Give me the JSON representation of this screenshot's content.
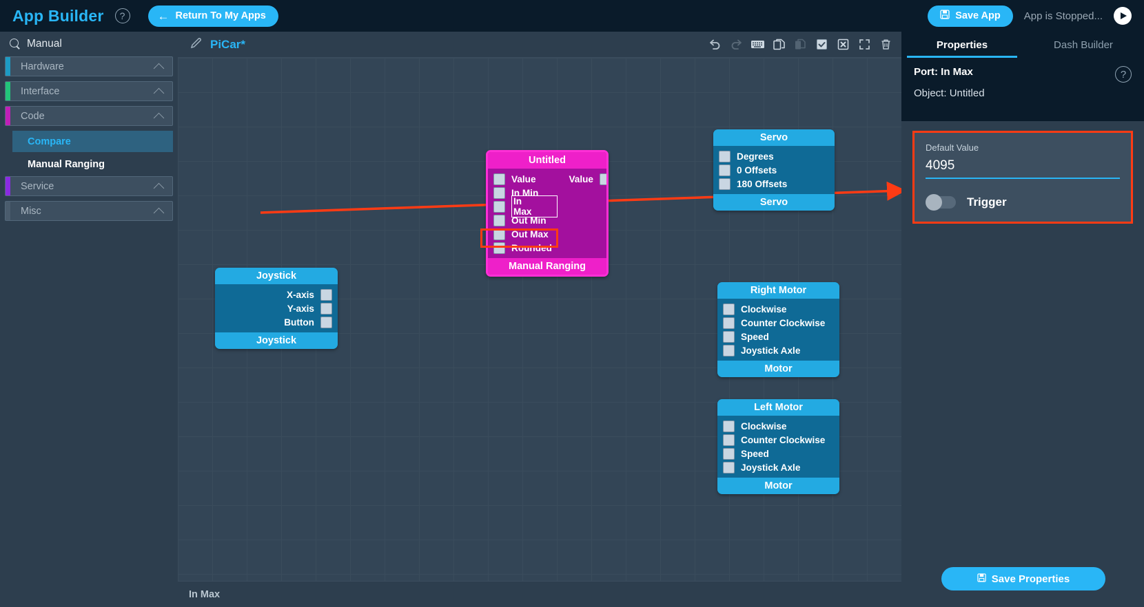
{
  "topbar": {
    "brand": "App Builder",
    "help_icon": "question-circle-icon",
    "return_label": "Return To My Apps",
    "back_arrow": "←",
    "save_app_label": "Save App",
    "save_icon": "floppy-disk-icon",
    "app_status": "App is Stopped...",
    "play_icon": "play-circle-icon"
  },
  "sidebar": {
    "search_icon": "search-icon",
    "search_value": "Manual",
    "categories": [
      {
        "label": "Hardware",
        "color": "#1d9bc4",
        "expanded": true
      },
      {
        "label": "Interface",
        "color": "#22c47a",
        "expanded": true
      },
      {
        "label": "Code",
        "color": "#c020b8",
        "expanded": true
      },
      {
        "label": "Service",
        "color": "#8a2be2",
        "expanded": true
      },
      {
        "label": "Misc",
        "color": "#4a5c6d",
        "expanded": true
      }
    ],
    "code_children": [
      {
        "label": "Compare",
        "active": true
      },
      {
        "label": "Manual Ranging",
        "active": false
      }
    ]
  },
  "canvas": {
    "pencil_icon": "pencil-icon",
    "project_title": "PiCar*",
    "status_text": "In Max",
    "toolbar": [
      {
        "name": "undo-icon",
        "label": "Undo",
        "enabled": true
      },
      {
        "name": "redo-icon",
        "label": "Redo",
        "enabled": false
      },
      {
        "name": "keyboard-icon",
        "label": "Keyboard",
        "enabled": true
      },
      {
        "name": "copy-icon",
        "label": "Copy",
        "enabled": true
      },
      {
        "name": "paste-icon",
        "label": "Paste",
        "enabled": false
      },
      {
        "name": "select-all-icon",
        "label": "Select All",
        "enabled": true
      },
      {
        "name": "deselect-icon",
        "label": "Deselect",
        "enabled": true
      },
      {
        "name": "fullscreen-icon",
        "label": "Fullscreen",
        "enabled": true
      },
      {
        "name": "trash-icon",
        "label": "Delete",
        "enabled": true
      }
    ]
  },
  "nodes": {
    "manual_ranging": {
      "header": "Untitled",
      "footer": "Manual Ranging",
      "inputs": [
        "Value",
        "In Min",
        "In Max",
        "Out Min",
        "Out Max",
        "Rounded"
      ],
      "outputs": [
        "Value"
      ],
      "selected_port": "In Max"
    },
    "servo": {
      "header": "Servo",
      "footer": "Servo",
      "inputs": [
        "Degrees",
        "0 Offsets",
        "180 Offsets"
      ]
    },
    "joystick": {
      "header": "Joystick",
      "footer": "Joystick",
      "outputs": [
        "X-axis",
        "Y-axis",
        "Button"
      ]
    },
    "right_motor": {
      "header": "Right Motor",
      "footer": "Motor",
      "inputs": [
        "Clockwise",
        "Counter Clockwise",
        "Speed",
        "Joystick Axle"
      ]
    },
    "left_motor": {
      "header": "Left Motor",
      "footer": "Motor",
      "inputs": [
        "Clockwise",
        "Counter Clockwise",
        "Speed",
        "Joystick Axle"
      ]
    }
  },
  "properties": {
    "tabs": [
      {
        "label": "Properties",
        "active": true
      },
      {
        "label": "Dash Builder",
        "active": false
      }
    ],
    "port_line_label": "Port:",
    "port_line_value": "In Max",
    "object_line_label": "Object:",
    "object_line_value": "Untitled",
    "help_icon": "question-circle-icon",
    "default_value_label": "Default Value",
    "default_value": "4095",
    "trigger_label": "Trigger",
    "trigger_on": false,
    "save_properties_label": "Save Properties",
    "save_properties_icon": "floppy-disk-icon"
  },
  "colors": {
    "accent": "#29b6f6",
    "highlight_red": "#ff3b14",
    "node_blue": "#23aae2",
    "node_magenta": "#ee20c9"
  }
}
